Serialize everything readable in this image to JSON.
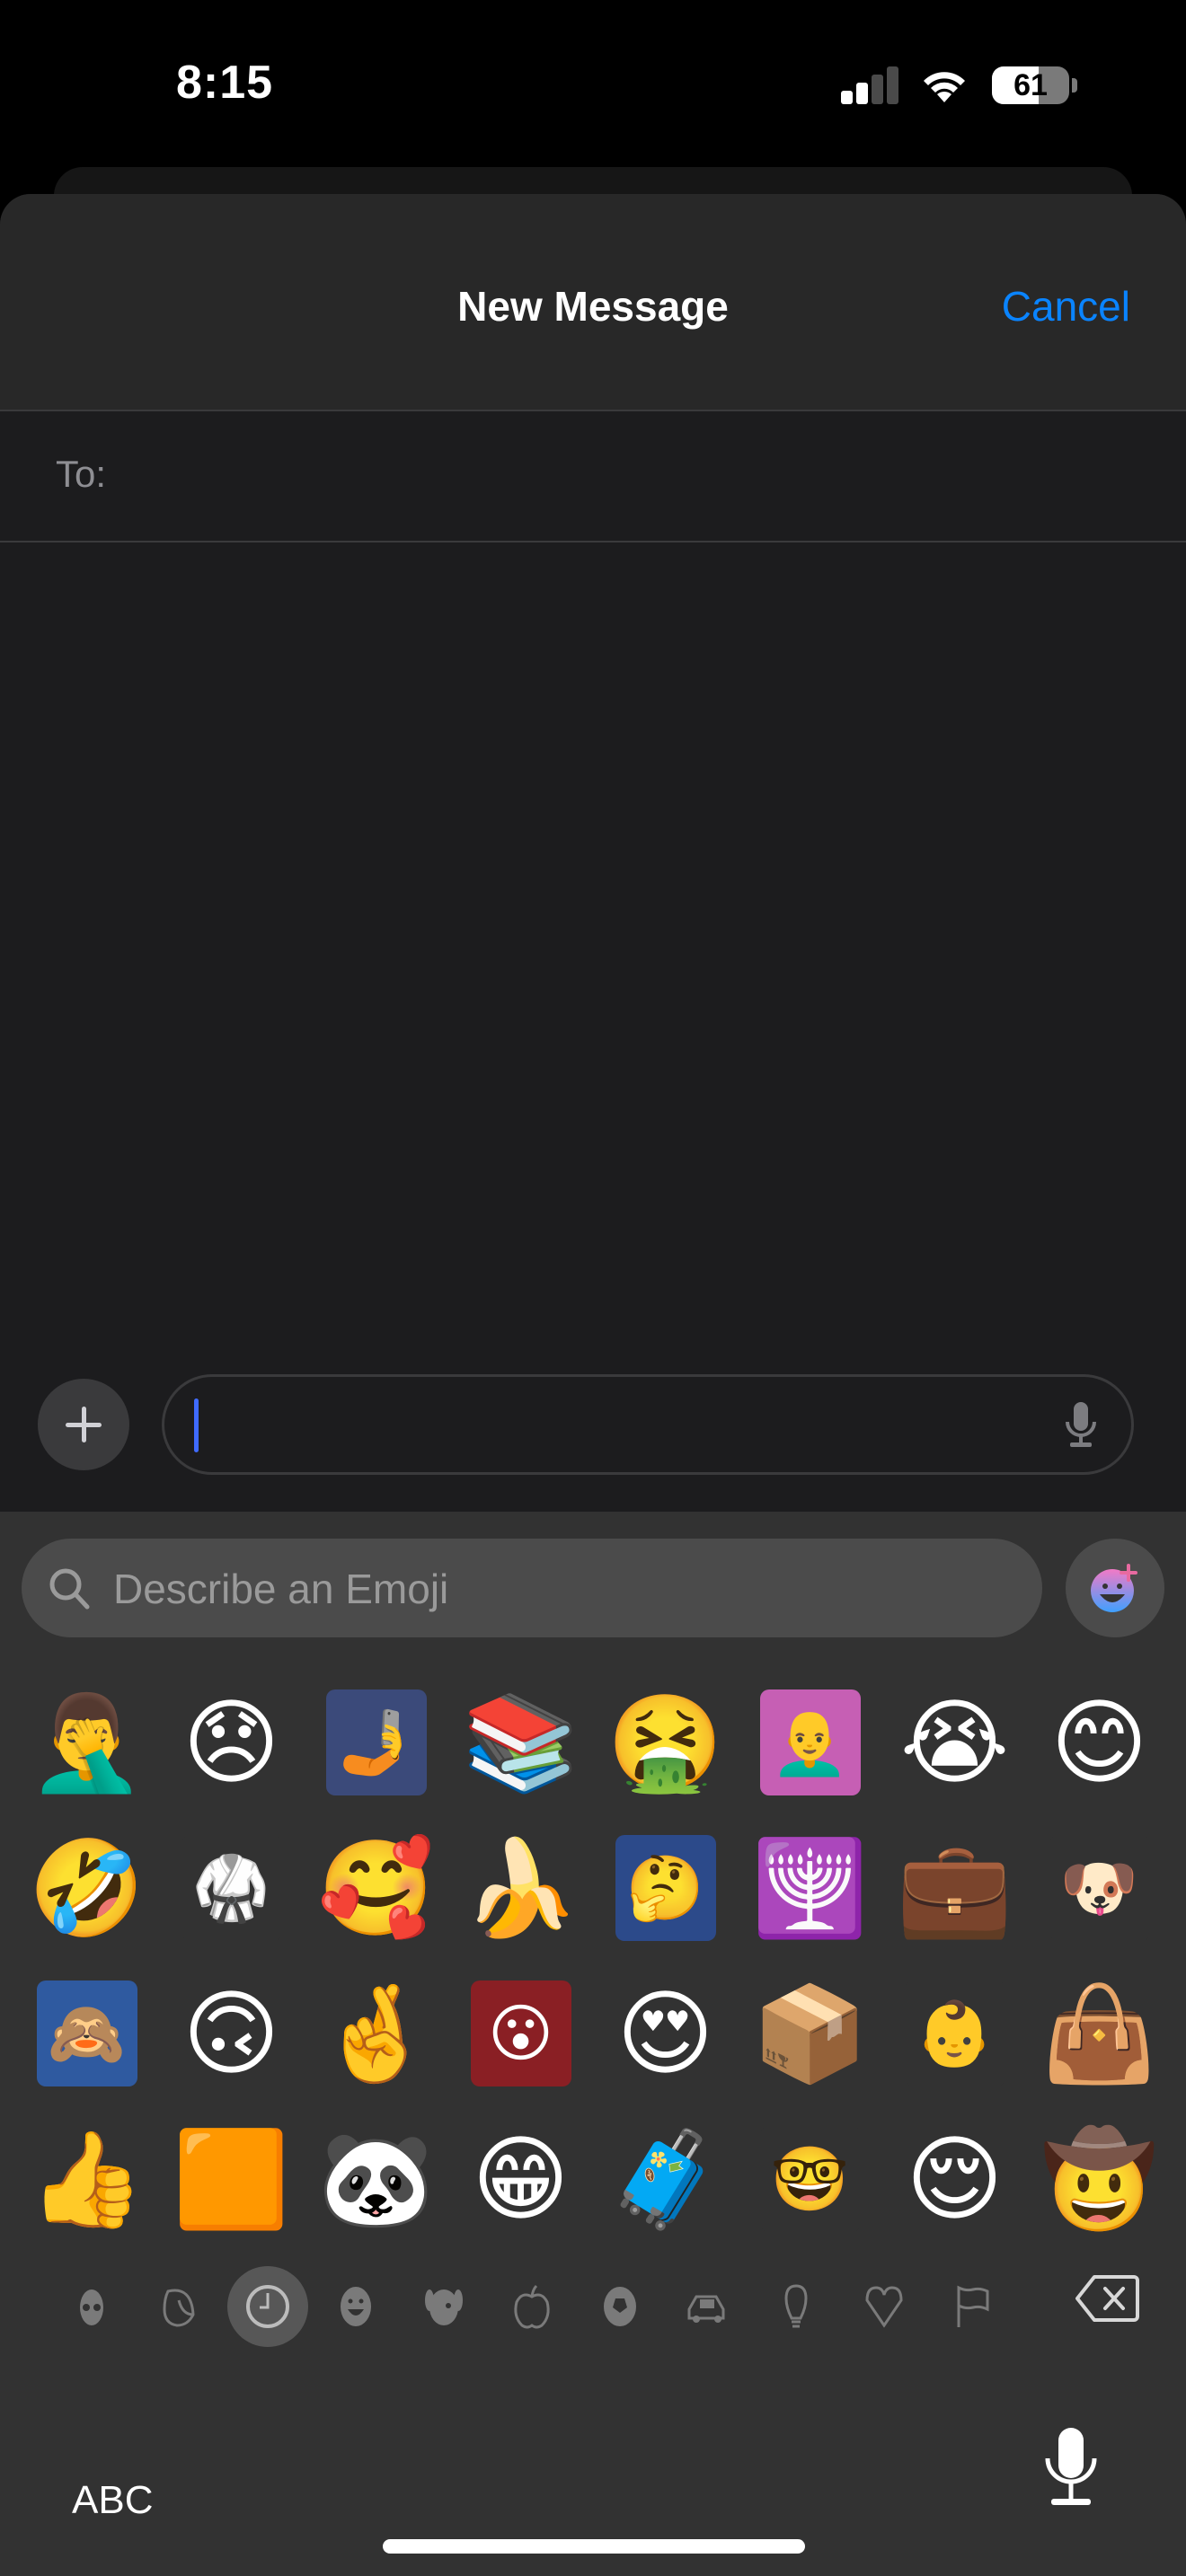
{
  "status_bar": {
    "time": "8:15",
    "signal_bars_active": 2,
    "signal_bars_total": 4,
    "wifi": "connected",
    "battery_percent": 61,
    "battery_label": "61"
  },
  "sheet": {
    "title": "New Message",
    "cancel_label": "Cancel",
    "to_label": "To:",
    "to_value": ""
  },
  "compose": {
    "plus_icon": "plus-icon",
    "message_value": "",
    "mic_icon": "microphone-icon"
  },
  "keyboard": {
    "search_placeholder": "Describe an Emoji",
    "genmoji_icon": "genmoji-sparkle-face-icon",
    "emoji_rows": [
      [
        {
          "kind": "emoji",
          "char": "🤦‍♂️",
          "name": "man-facepalming"
        },
        {
          "kind": "emoji",
          "char": "😞",
          "name": "disappointed-face"
        },
        {
          "kind": "sticker",
          "char": "🤳",
          "name": "photo-sticker-father-son",
          "bg": "#3b4a7a"
        },
        {
          "kind": "emoji",
          "char": "📚",
          "name": "books"
        },
        {
          "kind": "emoji",
          "char": "🤮",
          "name": "vomiting-face"
        },
        {
          "kind": "sticker",
          "char": "👨‍🦲",
          "name": "memoji-pink-shirt",
          "bg": "#c65fb4"
        },
        {
          "kind": "emoji",
          "char": "😭",
          "name": "loudly-crying-face"
        },
        {
          "kind": "emoji",
          "char": "😊",
          "name": "smiling-face-with-smiling-eyes"
        }
      ],
      [
        {
          "kind": "emoji",
          "char": "🤣",
          "name": "rolling-on-floor-laughing"
        },
        {
          "kind": "sticker",
          "char": "🥋",
          "name": "photo-sticker-karate-kid",
          "bg": "#323232"
        },
        {
          "kind": "emoji",
          "char": "🥰",
          "name": "smiling-face-with-hearts"
        },
        {
          "kind": "emoji",
          "char": "🍌",
          "name": "banana"
        },
        {
          "kind": "sticker",
          "char": "🤔",
          "name": "memoji-blue-blazer",
          "bg": "#2c4a8a"
        },
        {
          "kind": "emoji",
          "char": "🕎",
          "name": "menorah"
        },
        {
          "kind": "emoji",
          "char": "💼",
          "name": "briefcase"
        },
        {
          "kind": "sticker",
          "char": "🐶",
          "name": "snoopy-snorkel-sticker",
          "bg": "#323232"
        }
      ],
      [
        {
          "kind": "sticker",
          "char": "🙈",
          "name": "memoji-covering-eye",
          "bg": "#2f5aa0"
        },
        {
          "kind": "emoji",
          "char": "🙃",
          "name": "upside-down-face"
        },
        {
          "kind": "emoji",
          "char": "🤞",
          "name": "crossed-fingers"
        },
        {
          "kind": "sticker",
          "char": "😮",
          "name": "memoji-hand-on-cheek",
          "bg": "#8a1f24"
        },
        {
          "kind": "emoji",
          "char": "😍",
          "name": "smiling-face-with-heart-eyes"
        },
        {
          "kind": "emoji",
          "char": "📦",
          "name": "package"
        },
        {
          "kind": "sticker",
          "char": "👶",
          "name": "photo-sticker-baby-walker",
          "bg": "#323232"
        },
        {
          "kind": "emoji",
          "char": "👜",
          "name": "handbag"
        }
      ],
      [
        {
          "kind": "emoji",
          "char": "👍",
          "name": "thumbs-up"
        },
        {
          "kind": "emoji",
          "char": "🟧",
          "name": "orange-square"
        },
        {
          "kind": "emoji",
          "char": "🐼",
          "name": "panda-eating-sticker"
        },
        {
          "kind": "emoji",
          "char": "😁",
          "name": "beaming-face"
        },
        {
          "kind": "emoji",
          "char": "🧳",
          "name": "luggage"
        },
        {
          "kind": "sticker",
          "char": "🤓",
          "name": "memoji-head-glasses",
          "bg": "#323232"
        },
        {
          "kind": "emoji",
          "char": "😌",
          "name": "relieved-face"
        },
        {
          "kind": "emoji",
          "char": "🤠",
          "name": "cowboy-hat-face"
        }
      ]
    ],
    "categories": [
      {
        "name": "memoji",
        "icon": "memoji-heart-eyes-icon",
        "selected": false
      },
      {
        "name": "stickers",
        "icon": "sticker-peel-icon",
        "selected": false
      },
      {
        "name": "frequently-used",
        "icon": "clock-icon",
        "selected": true
      },
      {
        "name": "smileys",
        "icon": "smiley-icon",
        "selected": false
      },
      {
        "name": "animals",
        "icon": "dog-icon",
        "selected": false
      },
      {
        "name": "food",
        "icon": "apple-icon",
        "selected": false
      },
      {
        "name": "activity",
        "icon": "soccer-ball-icon",
        "selected": false
      },
      {
        "name": "travel",
        "icon": "car-icon",
        "selected": false
      },
      {
        "name": "objects",
        "icon": "lightbulb-icon",
        "selected": false
      },
      {
        "name": "symbols",
        "icon": "heart-icon",
        "selected": false
      },
      {
        "name": "flags",
        "icon": "flag-icon",
        "selected": false
      }
    ],
    "abc_label": "ABC",
    "delete_icon": "delete-backspace-icon",
    "dictation_icon": "microphone-icon"
  },
  "colors": {
    "accent": "#0a84ff",
    "caret": "#3f6bff",
    "sheet_header_bg": "#282828",
    "body_bg": "#1c1c1e",
    "keyboard_bg": "#323232",
    "search_field_bg": "#4b4b4b"
  }
}
